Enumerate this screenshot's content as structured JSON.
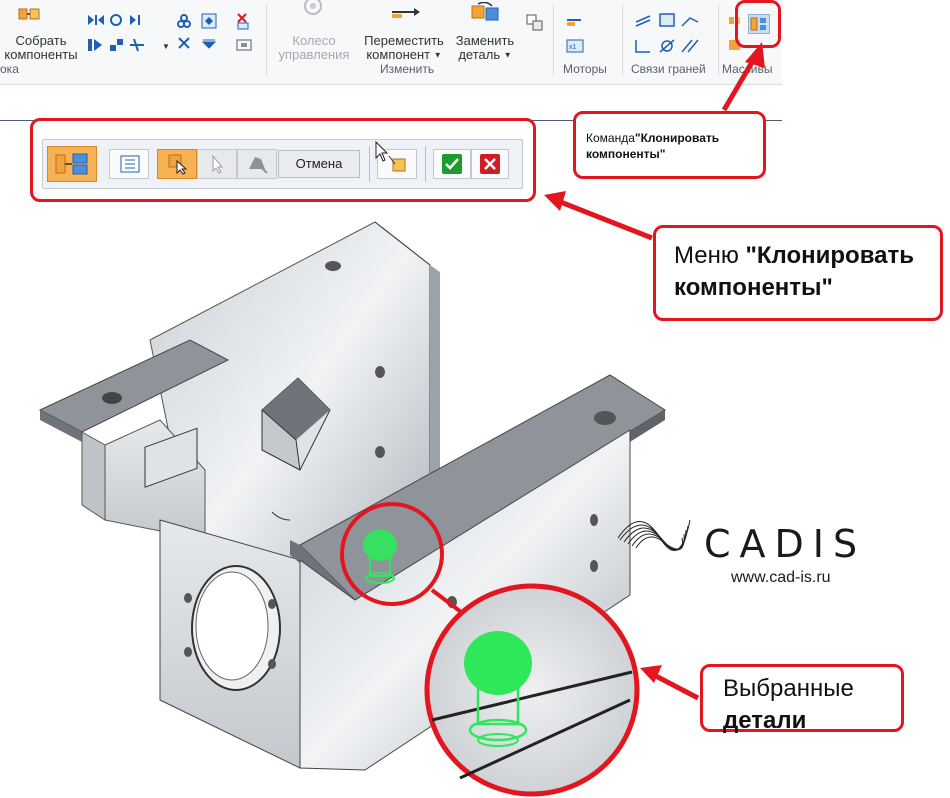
{
  "ribbon": {
    "assemble": {
      "line1": "Собрать",
      "line2": "компоненты"
    },
    "assemble_group_tail": "ока",
    "wheel": {
      "line1": "Колесо",
      "line2": "управления"
    },
    "move": {
      "line1": "Переместить",
      "line2": "компонент"
    },
    "replace": {
      "line1": "Заменить",
      "line2": "деталь"
    },
    "group_change": "Изменить",
    "group_motors": "Моторы",
    "group_links": "Связи граней",
    "group_arrays": "Массивы"
  },
  "commandbar": {
    "cancel_label": "Отмена"
  },
  "callouts": {
    "command": {
      "prefix": "Команда",
      "quote1": "\"Клонировать",
      "quote2": "компоненты\""
    },
    "menu": {
      "line1_prefix": "Меню ",
      "line1_bold": "\"Клонировать",
      "line2_bold": "компоненты\""
    },
    "selected": {
      "line1": "Выбранные",
      "line2": "детали"
    }
  },
  "logo": {
    "word": "CADIS",
    "url": "www.cad-is.ru"
  },
  "colors": {
    "annotation_red": "#e3161f",
    "highlight_green": "#2ee85a",
    "active_orange": "#f7b256"
  }
}
